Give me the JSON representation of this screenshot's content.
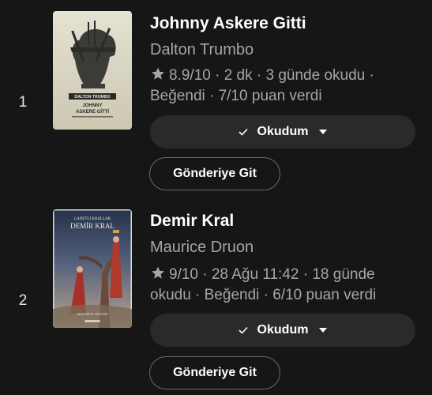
{
  "books": [
    {
      "rank": "1",
      "title": "Johnny Askere Gitti",
      "author": "Dalton Trumbo",
      "meta_line1": "8.9/10 · 2 dk · 3 günde okudu ·",
      "meta_line2": "Beğendi · 7/10 puan verdi",
      "status_label": "Okudum",
      "go_label": "Gönderiye Git",
      "cover": {
        "author_text": "DALTON TRUMBO",
        "title_line1": "JOHNNY",
        "title_line2": "ASKERE GİTTİ",
        "bg": "#ddd9c4",
        "accent": "#3d3d3a"
      }
    },
    {
      "rank": "2",
      "title": "Demir Kral",
      "author": "Maurice Druon",
      "meta_line1": "9/10 · 28 Ağu 11:42 · 18 günde",
      "meta_line2": "okudu · Beğendi · 6/10 puan verdi",
      "status_label": "Okudum",
      "go_label": "Gönderiye Git",
      "cover": {
        "series_text": "LANETLİ KRALLAR",
        "title_text": "DEMİR KRAL",
        "author_text": "MAURICE DRUON",
        "bg": "#3a4a63",
        "accent": "#b33a2a"
      }
    }
  ],
  "icons": {
    "star": "star-icon",
    "check": "check-icon",
    "caret": "caret-down-icon"
  },
  "colors": {
    "background": "#161616",
    "button_bg": "#2a2a2a",
    "secondary_text": "#a6a6a6",
    "outline": "#6a6a6a"
  }
}
